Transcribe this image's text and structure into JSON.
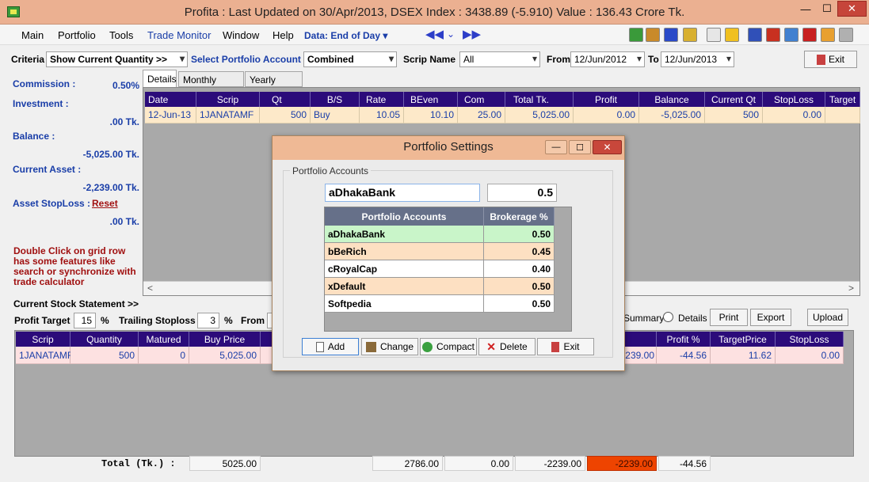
{
  "window": {
    "title": "Profita : Last Updated on 30/Apr/2013,  DSEX Index : 3438.89 (-5.910)  Value : 136.43 Crore Tk.",
    "min_glyph": "—",
    "max_glyph": "☐",
    "close_glyph": "✕"
  },
  "menu": {
    "items": [
      "Main",
      "Portfolio",
      "Tools",
      "Trade Monitor",
      "Window",
      "Help"
    ],
    "data_mode": "Data: End of Day"
  },
  "criteria": {
    "criteria_label": "Criteria",
    "criteria_value": "Show Current Quantity >>",
    "account_label": "Select Portfolio Account",
    "account_value": "Combined",
    "scrip_label": "Scrip Name",
    "scrip_value": "All",
    "from_label": "From",
    "from_value": "12/Jun/2012",
    "to_label": "To",
    "to_value": "12/Jun/2013",
    "exit_label": "Exit"
  },
  "summary": {
    "commission_label": "Commission :",
    "commission_value": "0.50%",
    "investment_label": "Investment :",
    "investment_value": ".00 Tk.",
    "balance_label": "Balance :",
    "balance_value": "-5,025.00 Tk.",
    "current_asset_label": "Current Asset :",
    "current_asset_value": "-2,239.00 Tk.",
    "asset_stoploss_label": "Asset StopLoss :",
    "reset_label": "Reset",
    "asset_stoploss_value": ".00 Tk.",
    "note": "Double Click on grid row has some features like search or synchronize with trade calculator"
  },
  "tabs": [
    "Details",
    "Monthly Report",
    "Yearly Report"
  ],
  "details_grid": {
    "columns": [
      "Date",
      "Scrip",
      "Qt",
      "B/S",
      "Rate",
      "BEven",
      "Com",
      "Total Tk.",
      "Profit",
      "Balance",
      "Current Qt",
      "StopLoss",
      "Target"
    ],
    "rows": [
      [
        "12-Jun-13",
        "1JANATAMF",
        "500",
        "Buy",
        "10.05",
        "10.10",
        "25.00",
        "5,025.00",
        "0.00",
        "-5,025.00",
        "500",
        "0.00",
        ""
      ]
    ]
  },
  "stock_statement": {
    "label": "Current Stock Statement >>",
    "profit_target_label": "Profit Target",
    "profit_target_value": "15",
    "pct1": "%",
    "trailing_label": "Trailing Stoploss",
    "trailing_value": "3",
    "pct2": "%",
    "from_label": "From",
    "summary_label": "Summary",
    "details_label": "Details",
    "print_label": "Print",
    "export_label": "Export",
    "upload_label": "Upload",
    "columns": [
      "Scrip",
      "Quantity",
      "Matured",
      "Buy Price",
      "Profit %",
      "TargetPrice",
      "StopLoss"
    ],
    "rows": [
      {
        "scrip": "1JANATAMF",
        "quantity": "500",
        "matured": "0",
        "buy_price": "5,025.00",
        "hidden_value": "2,239.00",
        "profit_pct": "-44.56",
        "target_price": "11.62",
        "stoploss": "0.00"
      }
    ]
  },
  "totals": {
    "label": "Total (Tk.) :",
    "buy_total": "5025.00",
    "t2": "2786.00",
    "t3": "0.00",
    "t4": "-2239.00",
    "t5": "-2239.00",
    "t6": "-44.56"
  },
  "dialog": {
    "title": "Portfolio Settings",
    "group_label": "Portfolio Accounts",
    "name_value": "aDhakaBank",
    "brokerage_value": "0.5",
    "columns": [
      "Portfolio Accounts",
      "Brokerage %"
    ],
    "rows": [
      {
        "name": "aDhakaBank",
        "brokerage": "0.50"
      },
      {
        "name": "bBeRich",
        "brokerage": "0.45"
      },
      {
        "name": "cRoyalCap",
        "brokerage": "0.40"
      },
      {
        "name": "xDefault",
        "brokerage": "0.50"
      },
      {
        "name": "Softpedia",
        "brokerage": "0.50"
      }
    ],
    "buttons": {
      "add": "Add",
      "change": "Change",
      "compact": "Compact",
      "delete": "Delete",
      "exit": "Exit"
    }
  },
  "colors": {
    "header_dark": "#2b0b7a",
    "title_bar": "#ebb091",
    "row_selected": "#c9f5c9",
    "row_alt": "#fde0c2",
    "highlight_red": "#ee4400"
  }
}
